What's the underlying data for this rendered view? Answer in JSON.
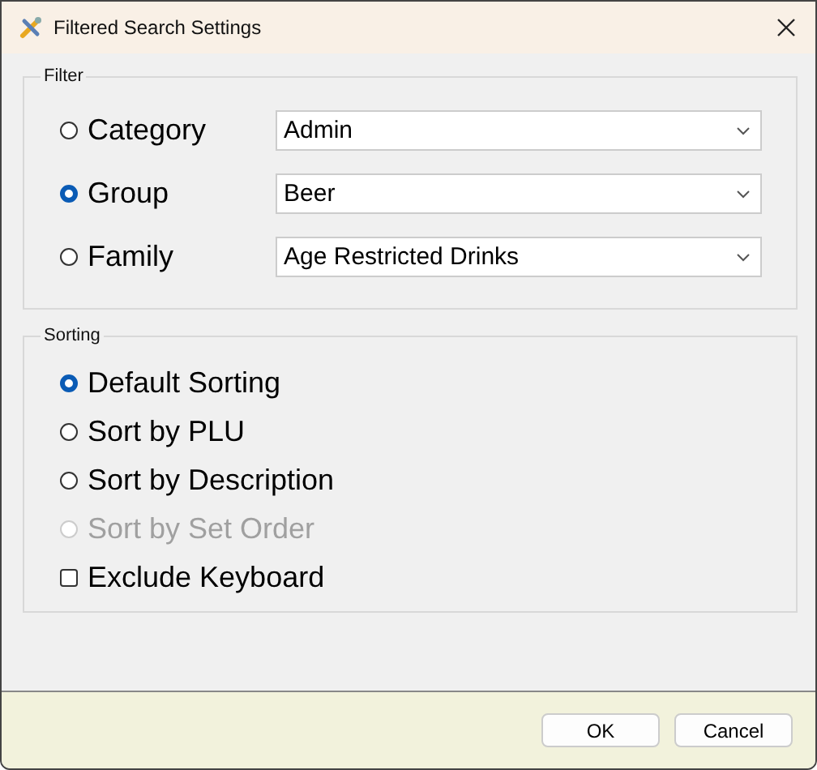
{
  "window": {
    "title": "Filtered Search Settings"
  },
  "filter": {
    "legend": "Filter",
    "options": [
      {
        "label": "Category",
        "selected": false,
        "value": "Admin"
      },
      {
        "label": "Group",
        "selected": true,
        "value": "Beer"
      },
      {
        "label": "Family",
        "selected": false,
        "value": "Age Restricted Drinks"
      }
    ]
  },
  "sorting": {
    "legend": "Sorting",
    "options": [
      {
        "kind": "radio",
        "label": "Default Sorting",
        "selected": true,
        "disabled": false
      },
      {
        "kind": "radio",
        "label": "Sort by PLU",
        "selected": false,
        "disabled": false
      },
      {
        "kind": "radio",
        "label": "Sort by Description",
        "selected": false,
        "disabled": false
      },
      {
        "kind": "radio",
        "label": "Sort by Set Order",
        "selected": false,
        "disabled": true
      },
      {
        "kind": "checkbox",
        "label": "Exclude Keyboard",
        "checked": false
      }
    ]
  },
  "buttons": [
    "OK",
    "Cancel"
  ]
}
